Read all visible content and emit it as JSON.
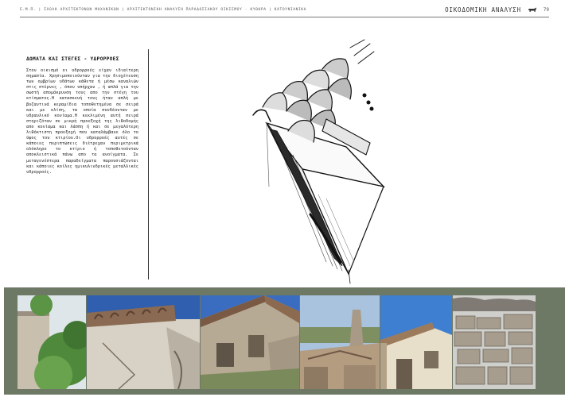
{
  "header": {
    "breadcrumb": "Ε.Μ.Π. | ΣΧΟΛΗ ΑΡΧΙΤΕΚΤΟΝΩΝ ΜΗΧΑΝΙΚΩΝ | ΑΡΧΙΤΕΚΤΟΝΙΚΗ ΑΝΑΛΥΣΗ ΠΑΡΑΔΟΣΙΑΚΟΥ ΟΙΚΙΣΜΟΥ - ΚΥΘΗΡΑ | ΚΑΤΟΥΝΙΑΝΙΚΑ",
    "section_title": "ΟΙΚΟΔΟΜΙΚΗ ΑΝΑΛΥΣΗ",
    "section_icon": "goat-icon",
    "page_number": "79"
  },
  "article": {
    "heading": "ΔΩΜΑΤΑ ΚΑΙ ΣΤΕΓΕΣ - ΥΔΡΟΡΡΟΕΣ",
    "body": "Στον οικισμό οι υδρορροές είχαν ιδιαίτερη σημασία. Χρησιμοποιούνταν για την διοχέτευση των ομβρίων υδάτων κάθετα ή μέσω καναλιών στις στέρνες , όπου υπήρχαν , ή απλά για την σωστή απομάκρυνση τους απο την στέγη του κτίσματος.Η κατασκευή τους ήταν απλή με βυζαντινά κεραμίδια τοποθετημένα σε σειρά και με κλίση, τα οποία συνδέονταν με υδραυλικό κονίαμα.Η κεκλιμένη αυτή σειρά στηριζόταν σε μικρή προεξοχή της λιθοδομής απο κονίαμα και λάσπη ή και σε μεγαλύτερη λιθόκτιστη προεξοχή που καταλάμβανε όλο το ύψος του κτιρίου.Οι υδρορροές αυτές σε κάποιες περιπτώσεις διέτρεχαν περιμετρικά ολόκληρο το κτίριο ή τοποθετούνταν αποκλειστικά πάνω απο τα ανοίγματα. Σε μεταγενέστερα παραδείγματα παρουσιάζονται και κάποιες κοίλες ημικυλινδρικές μεταλλικές υδρορροές."
  },
  "figure": {
    "sketch_icon": "roof-gutter-sketch",
    "photos": [
      {
        "name": "photo-gutter-tree"
      },
      {
        "name": "photo-tiled-wall"
      },
      {
        "name": "photo-ruined-house"
      },
      {
        "name": "photo-ruin-chimney"
      },
      {
        "name": "photo-white-house"
      },
      {
        "name": "photo-stone-wall"
      }
    ]
  },
  "colors": {
    "photo_band": "#6d7865",
    "sky": "#2f5fae",
    "foliage": "#4f8a3c",
    "stone": "#b7aa95"
  }
}
